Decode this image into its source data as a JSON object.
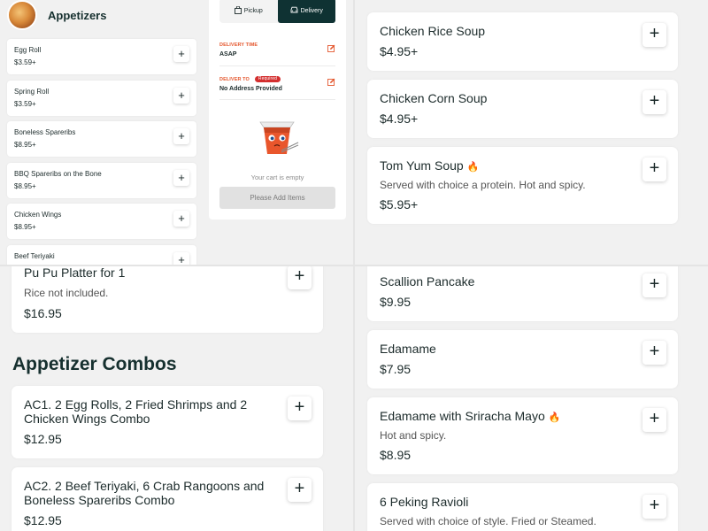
{
  "appetizers": {
    "title": "Appetizers",
    "items": [
      {
        "name": "Egg Roll",
        "price": "$3.59+"
      },
      {
        "name": "Spring Roll",
        "price": "$3.59+"
      },
      {
        "name": "Boneless Spareribs",
        "price": "$8.95+"
      },
      {
        "name": "BBQ Spareribs on the Bone",
        "price": "$8.95+"
      },
      {
        "name": "Chicken Wings",
        "price": "$8.95+"
      },
      {
        "name": "Beef Teriyaki",
        "price": ""
      }
    ],
    "plus": "+"
  },
  "cart": {
    "pickup_label": "Pickup",
    "delivery_label": "Delivery",
    "active_mode": "Delivery",
    "delivery_time_label": "DELIVERY TIME",
    "delivery_time_value": "ASAP",
    "deliver_to_label": "DELIVER TO",
    "required_badge": "Required",
    "deliver_to_value": "No Address Provided",
    "empty_text": "Your cart is empty",
    "add_button": "Please Add Items",
    "accent_color": "#e4572e",
    "dark_color": "#0f3233"
  },
  "soups": {
    "items": [
      {
        "name": "Chicken Rice Soup",
        "price": "$4.95+"
      },
      {
        "name": "Chicken Corn Soup",
        "price": "$4.95+"
      },
      {
        "name": "Tom Yum Soup",
        "description": "Served with choice a protein. Hot and spicy.",
        "price": "$5.95+",
        "spicy": true
      }
    ]
  },
  "platter": {
    "name": "Pu Pu Platter for 1",
    "description": "Rice not included.",
    "price": "$16.95"
  },
  "combos": {
    "title": "Appetizer Combos",
    "items": [
      {
        "name_line1": "AC1. 2 Egg Rolls, 2 Fried Shrimps and 2",
        "name_line2": "Chicken Wings Combo",
        "price": "$12.95"
      },
      {
        "name_line1": "AC2. 2 Beef Teriyaki, 6 Crab Rangoons and",
        "name_line2": "Boneless Spareribs Combo",
        "price": "$12.95"
      }
    ]
  },
  "sides": {
    "items": [
      {
        "name": "Scallion Pancake",
        "price": "$9.95"
      },
      {
        "name": "Edamame",
        "price": "$7.95"
      },
      {
        "name": "Edamame with Sriracha Mayo",
        "description": "Hot and spicy.",
        "price": "$8.95",
        "spicy": true
      },
      {
        "name": "6 Peking Ravioli",
        "description": "Served with choice of style. Fried or Steamed."
      }
    ]
  },
  "icons": {
    "plus": "+",
    "flame": "🔥",
    "edit": "✎",
    "bag": "🛍",
    "car": "🚘"
  }
}
